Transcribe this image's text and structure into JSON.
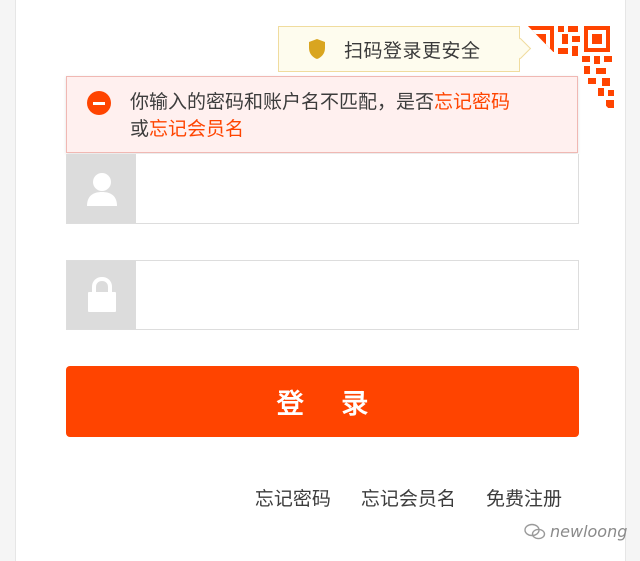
{
  "qr_tip": {
    "text": "扫码登录更安全",
    "icon": "shield-icon"
  },
  "qr_corner": {
    "icon": "qr-code-icon"
  },
  "error": {
    "icon": "minus-circle-icon",
    "text_before": "你输入的密码和账户名不匹配，是否",
    "link_forgot_password": "忘记密码",
    "text_or": "或",
    "link_forgot_member": "忘记会员名"
  },
  "username": {
    "value": "",
    "placeholder": "",
    "icon": "user-icon"
  },
  "password": {
    "value": "",
    "placeholder": "",
    "icon": "lock-icon"
  },
  "login_button": {
    "label": "登 录"
  },
  "links": {
    "forgot_password": "忘记密码",
    "forgot_member": "忘记会员名",
    "register": "免费注册"
  },
  "watermark": {
    "text": "newloong"
  },
  "colors": {
    "accent": "#ff4400",
    "error_bg": "#fff0ef",
    "tip_bg": "#fefcee",
    "icon_cell_bg": "#dcdcdc"
  }
}
